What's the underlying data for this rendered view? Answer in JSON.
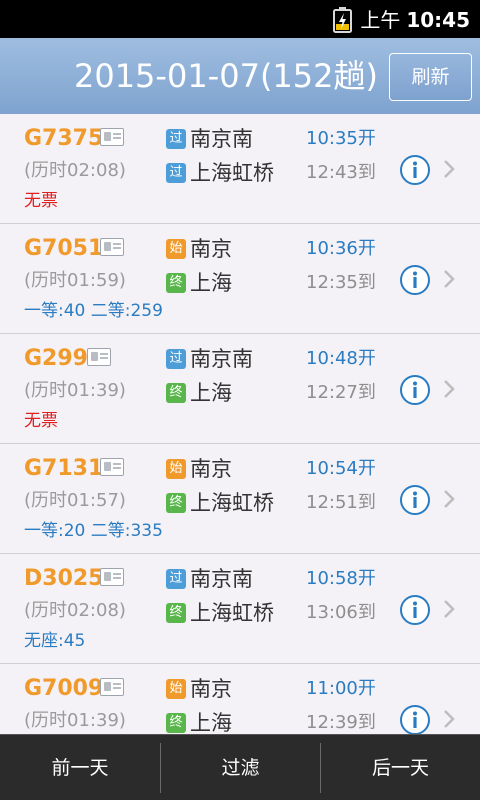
{
  "status_bar": {
    "ampm": "上午",
    "time": "10:45",
    "icons": [
      "battery-charging-icon"
    ]
  },
  "header": {
    "title": "2015-01-07(152趟)",
    "refresh_label": "刷新"
  },
  "colors": {
    "header_top": "#9fbde0",
    "header_bottom": "#7ea3cf",
    "train_no": "#f09a2c",
    "dep_time": "#2a7cc2",
    "no_ticket": "#e02020",
    "badge_pass": "#4d9ed8",
    "badge_start": "#f09a2c",
    "badge_end": "#58b64a"
  },
  "trains": [
    {
      "train_no": "G7375",
      "duration": "(历时02:08)",
      "from_badge": "过",
      "from_badge_type": "pass",
      "from_station": "南京南",
      "dep_time": "10:35开",
      "to_badge": "过",
      "to_badge_type": "pass",
      "to_station": "上海虹桥",
      "arr_time": "12:43到",
      "tickets": "无票",
      "ticket_status": "none"
    },
    {
      "train_no": "G7051",
      "duration": "(历时01:59)",
      "from_badge": "始",
      "from_badge_type": "start",
      "from_station": "南京",
      "dep_time": "10:36开",
      "to_badge": "终",
      "to_badge_type": "end",
      "to_station": "上海",
      "arr_time": "12:35到",
      "tickets": "一等:40  二等:259",
      "ticket_status": "avail"
    },
    {
      "train_no": "G299",
      "duration": "(历时01:39)",
      "from_badge": "过",
      "from_badge_type": "pass",
      "from_station": "南京南",
      "dep_time": "10:48开",
      "to_badge": "终",
      "to_badge_type": "end",
      "to_station": "上海",
      "arr_time": "12:27到",
      "tickets": "无票",
      "ticket_status": "none"
    },
    {
      "train_no": "G7131",
      "duration": "(历时01:57)",
      "from_badge": "始",
      "from_badge_type": "start",
      "from_station": "南京",
      "dep_time": "10:54开",
      "to_badge": "终",
      "to_badge_type": "end",
      "to_station": "上海虹桥",
      "arr_time": "12:51到",
      "tickets": "一等:20  二等:335",
      "ticket_status": "avail"
    },
    {
      "train_no": "D3025",
      "duration": "(历时02:08)",
      "from_badge": "过",
      "from_badge_type": "pass",
      "from_station": "南京南",
      "dep_time": "10:58开",
      "to_badge": "终",
      "to_badge_type": "end",
      "to_station": "上海虹桥",
      "arr_time": "13:06到",
      "tickets": "无座:45",
      "ticket_status": "avail"
    },
    {
      "train_no": "G7009",
      "duration": "(历时01:39)",
      "from_badge": "始",
      "from_badge_type": "start",
      "from_station": "南京",
      "dep_time": "11:00开",
      "to_badge": "终",
      "to_badge_type": "end",
      "to_station": "上海",
      "arr_time": "12:39到",
      "tickets": "",
      "ticket_status": "avail"
    }
  ],
  "bottom_bar": {
    "prev_label": "前一天",
    "filter_label": "过滤",
    "next_label": "后一天"
  }
}
